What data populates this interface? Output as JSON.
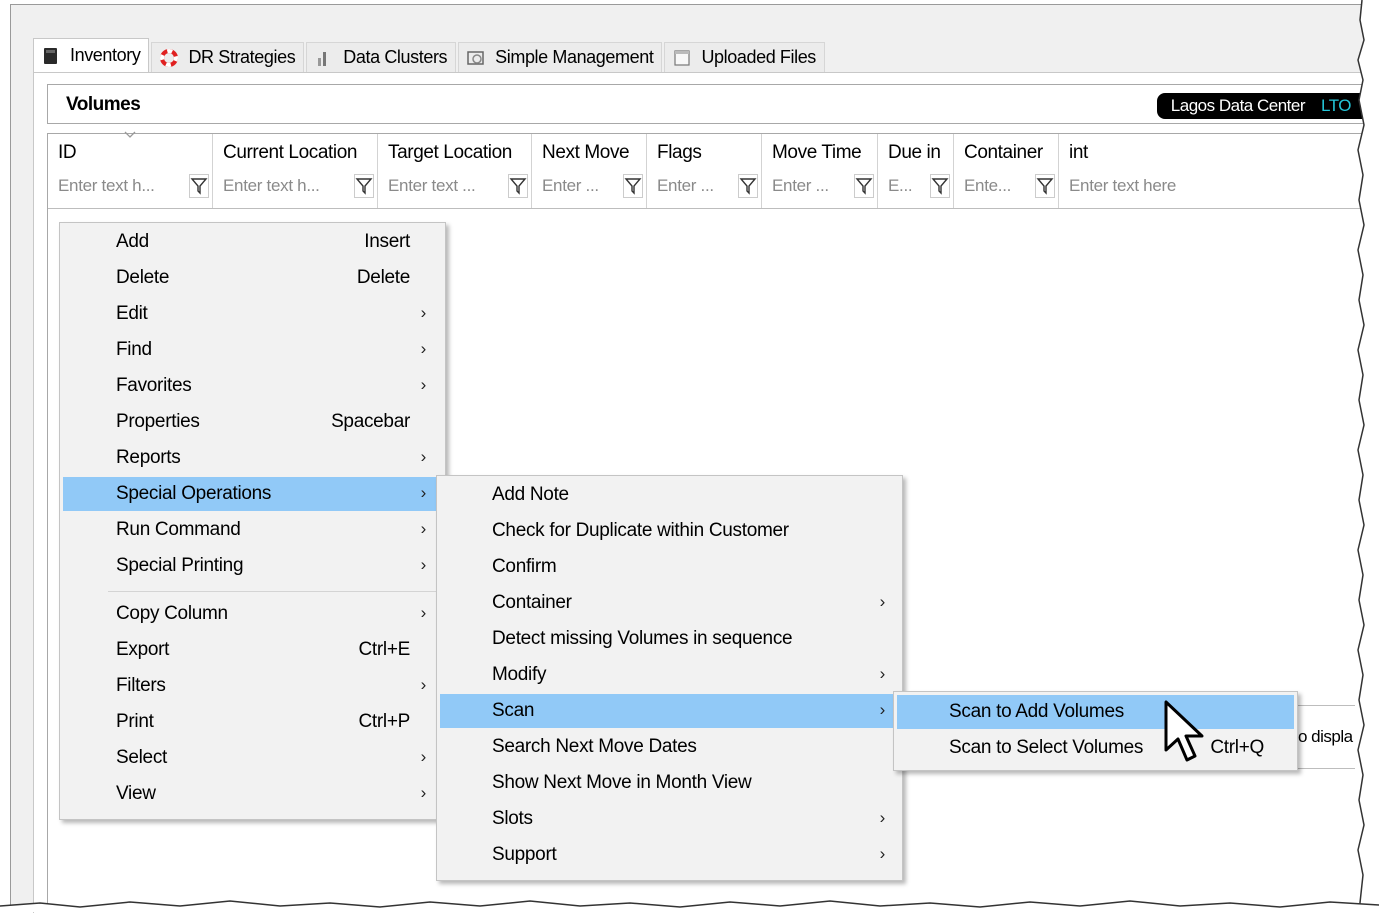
{
  "tabs": [
    {
      "label": "Inventory",
      "icon": "book-icon"
    },
    {
      "label": "DR Strategies",
      "icon": "lifebuoy-icon"
    },
    {
      "label": "Data Clusters",
      "icon": "cluster-icon"
    },
    {
      "label": "Simple Management",
      "icon": "management-icon"
    },
    {
      "label": "Uploaded Files",
      "icon": "file-icon"
    }
  ],
  "volumes": {
    "title": "Volumes",
    "datacenter": "Lagos Data Center",
    "media": "LTO"
  },
  "grid": {
    "columns": [
      {
        "label": "ID",
        "filter": "Enter text h..."
      },
      {
        "label": "Current Location",
        "filter": "Enter text h..."
      },
      {
        "label": "Target Location",
        "filter": "Enter text ..."
      },
      {
        "label": "Next Move",
        "filter": "Enter ..."
      },
      {
        "label": "Flags",
        "filter": "Enter ..."
      },
      {
        "label": "Move Time",
        "filter": "Enter ..."
      },
      {
        "label": "Due in",
        "filter": "E..."
      },
      {
        "label": "Container",
        "filter": "Ente..."
      },
      {
        "label": "int",
        "filter": "Enter text here"
      }
    ],
    "partial_text": "o displa"
  },
  "context_menu": {
    "items": [
      {
        "label": "Add",
        "shortcut": "Insert"
      },
      {
        "label": "Delete",
        "shortcut": "Delete"
      },
      {
        "label": "Edit",
        "arrow": "›"
      },
      {
        "label": "Find",
        "arrow": "›"
      },
      {
        "label": "Favorites",
        "arrow": "›"
      },
      {
        "label": "Properties",
        "shortcut": "Spacebar"
      },
      {
        "label": "Reports",
        "arrow": "›"
      },
      {
        "label": "Special Operations",
        "arrow": "›"
      },
      {
        "label": "Run Command",
        "arrow": "›"
      },
      {
        "label": "Special Printing",
        "arrow": "›"
      },
      {
        "label": "Copy Column",
        "arrow": "›"
      },
      {
        "label": "Export",
        "shortcut": "Ctrl+E"
      },
      {
        "label": "Filters",
        "arrow": "›"
      },
      {
        "label": "Print",
        "shortcut": "Ctrl+P"
      },
      {
        "label": "Select",
        "arrow": "›"
      },
      {
        "label": "View",
        "arrow": "›"
      }
    ]
  },
  "special_operations_menu": {
    "items": [
      {
        "label": "Add Note"
      },
      {
        "label": "Check for Duplicate within Customer"
      },
      {
        "label": "Confirm"
      },
      {
        "label": "Container",
        "arrow": "›"
      },
      {
        "label": "Detect missing Volumes in sequence"
      },
      {
        "label": "Modify",
        "arrow": "›"
      },
      {
        "label": "Scan",
        "arrow": "›"
      },
      {
        "label": "Search Next Move Dates"
      },
      {
        "label": "Show Next Move in Month View"
      },
      {
        "label": "Slots",
        "arrow": "›"
      },
      {
        "label": "Support",
        "arrow": "›"
      }
    ]
  },
  "scan_menu": {
    "items": [
      {
        "label": "Scan to Add Volumes"
      },
      {
        "label": "Scan to Select Volumes",
        "shortcut": "Ctrl+Q"
      }
    ]
  },
  "colors": {
    "highlight": "#91c9f7",
    "menu_bg": "#f2f2f2",
    "badge_bg": "#000000",
    "lto_accent": "#24c6d8"
  }
}
